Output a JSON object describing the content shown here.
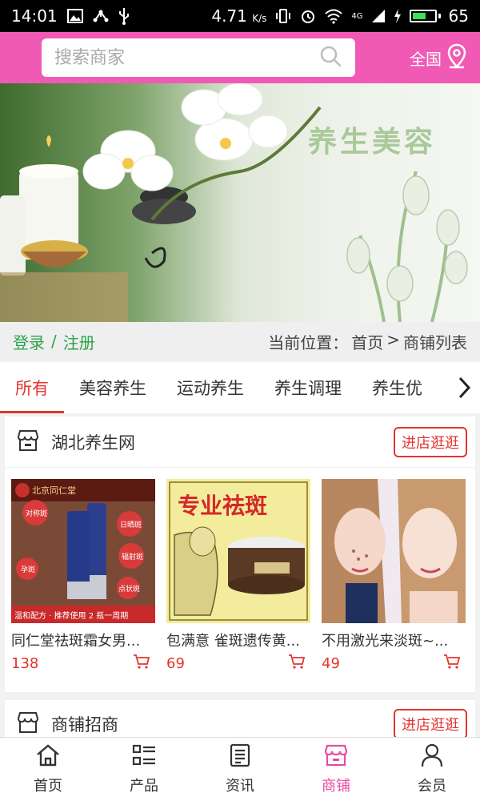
{
  "status_bar": {
    "time": "14:01",
    "speed": "4.71",
    "speed_unit": "K/s",
    "network": "4G",
    "battery": "65",
    "battery_level": 0.65
  },
  "header": {
    "search_placeholder": "搜索商家",
    "region_label": "全国"
  },
  "banner": {
    "title": "养生美容"
  },
  "info_strip": {
    "login": "登录",
    "separator": "/",
    "register": "注册",
    "breadcrumb_prefix": "当前位置：",
    "breadcrumb_home": "首页",
    "breadcrumb_arrow": ">",
    "breadcrumb_current": "商铺列表"
  },
  "tabs": [
    {
      "label": "所有"
    },
    {
      "label": "美容养生"
    },
    {
      "label": "运动养生"
    },
    {
      "label": "养生调理"
    },
    {
      "label": "养生优"
    }
  ],
  "shops": [
    {
      "name": "湖北养生网",
      "button": "进店逛逛",
      "products": [
        {
          "name": "同仁堂祛斑霜女男...",
          "price": "138",
          "img_lines": [
            "北京同仁堂",
            "对称斑",
            "日晒斑",
            "辐射斑",
            "孕斑",
            "点状斑",
            "温和配方 · 推荐使用 2 瓶一周期"
          ]
        },
        {
          "name": "包满意 雀斑遗传黄...",
          "price": "69",
          "img_lines": [
            "专业祛斑"
          ]
        },
        {
          "name": "不用激光来淡斑~...",
          "price": "49",
          "img_lines": []
        }
      ]
    },
    {
      "name": "商铺招商",
      "button": "进店逛逛",
      "products": []
    }
  ],
  "bottom_nav": [
    {
      "label": "首页",
      "icon": "home-icon",
      "active": false
    },
    {
      "label": "产品",
      "icon": "list-icon",
      "active": false
    },
    {
      "label": "资讯",
      "icon": "news-icon",
      "active": false
    },
    {
      "label": "商铺",
      "icon": "shop-icon",
      "active": true
    },
    {
      "label": "会员",
      "icon": "user-icon",
      "active": false
    }
  ],
  "colors": {
    "header": "#f05ab5",
    "accent_red": "#e3352e",
    "nav_active": "#e84ba3",
    "login_green": "#2aa34a"
  }
}
